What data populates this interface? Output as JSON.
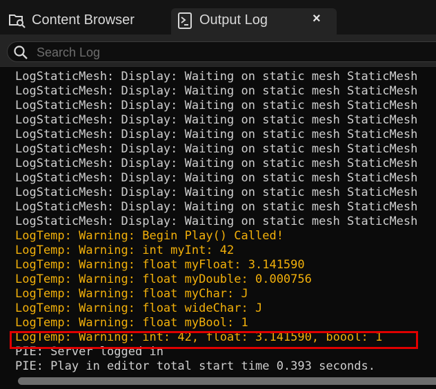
{
  "tabs": {
    "content_browser": {
      "label": "Content Browser",
      "icon": "folder-search-icon"
    },
    "output_log": {
      "label": "Output Log",
      "icon": "terminal-icon",
      "close": "×"
    }
  },
  "search": {
    "placeholder": "Search Log",
    "value": ""
  },
  "colors": {
    "display": "#cfcfcf",
    "warning": "#f2b00a",
    "pie": "#cfcfcf",
    "highlight": "#e00000"
  },
  "log": {
    "lines": [
      {
        "text": "LogStaticMesh: Display: Waiting on static mesh StaticMesh",
        "level": "display"
      },
      {
        "text": "LogStaticMesh: Display: Waiting on static mesh StaticMesh",
        "level": "display"
      },
      {
        "text": "LogStaticMesh: Display: Waiting on static mesh StaticMesh",
        "level": "display"
      },
      {
        "text": "LogStaticMesh: Display: Waiting on static mesh StaticMesh",
        "level": "display"
      },
      {
        "text": "LogStaticMesh: Display: Waiting on static mesh StaticMesh",
        "level": "display"
      },
      {
        "text": "LogStaticMesh: Display: Waiting on static mesh StaticMesh",
        "level": "display"
      },
      {
        "text": "LogStaticMesh: Display: Waiting on static mesh StaticMesh",
        "level": "display"
      },
      {
        "text": "LogStaticMesh: Display: Waiting on static mesh StaticMesh",
        "level": "display"
      },
      {
        "text": "LogStaticMesh: Display: Waiting on static mesh StaticMesh",
        "level": "display"
      },
      {
        "text": "LogStaticMesh: Display: Waiting on static mesh StaticMesh",
        "level": "display"
      },
      {
        "text": "LogStaticMesh: Display: Waiting on static mesh StaticMesh",
        "level": "display"
      },
      {
        "text": "LogTemp: Warning: Begin Play() Called!",
        "level": "warning"
      },
      {
        "text": "LogTemp: Warning: int myInt: 42",
        "level": "warning"
      },
      {
        "text": "LogTemp: Warning: float myFloat: 3.141590",
        "level": "warning"
      },
      {
        "text": "LogTemp: Warning: float myDouble: 0.000756",
        "level": "warning"
      },
      {
        "text": "LogTemp: Warning: float myChar: J",
        "level": "warning"
      },
      {
        "text": "LogTemp: Warning: float wideChar: J",
        "level": "warning"
      },
      {
        "text": "LogTemp: Warning: float myBool: 1",
        "level": "warning"
      },
      {
        "text": "LogTemp: Warning: int: 42, float: 3.141590, boool: 1",
        "level": "warning",
        "highlighted": true
      },
      {
        "text": "PIE: Server logged in",
        "level": "pie"
      },
      {
        "text": "PIE: Play in editor total start time 0.393 seconds.",
        "level": "pie"
      }
    ]
  }
}
